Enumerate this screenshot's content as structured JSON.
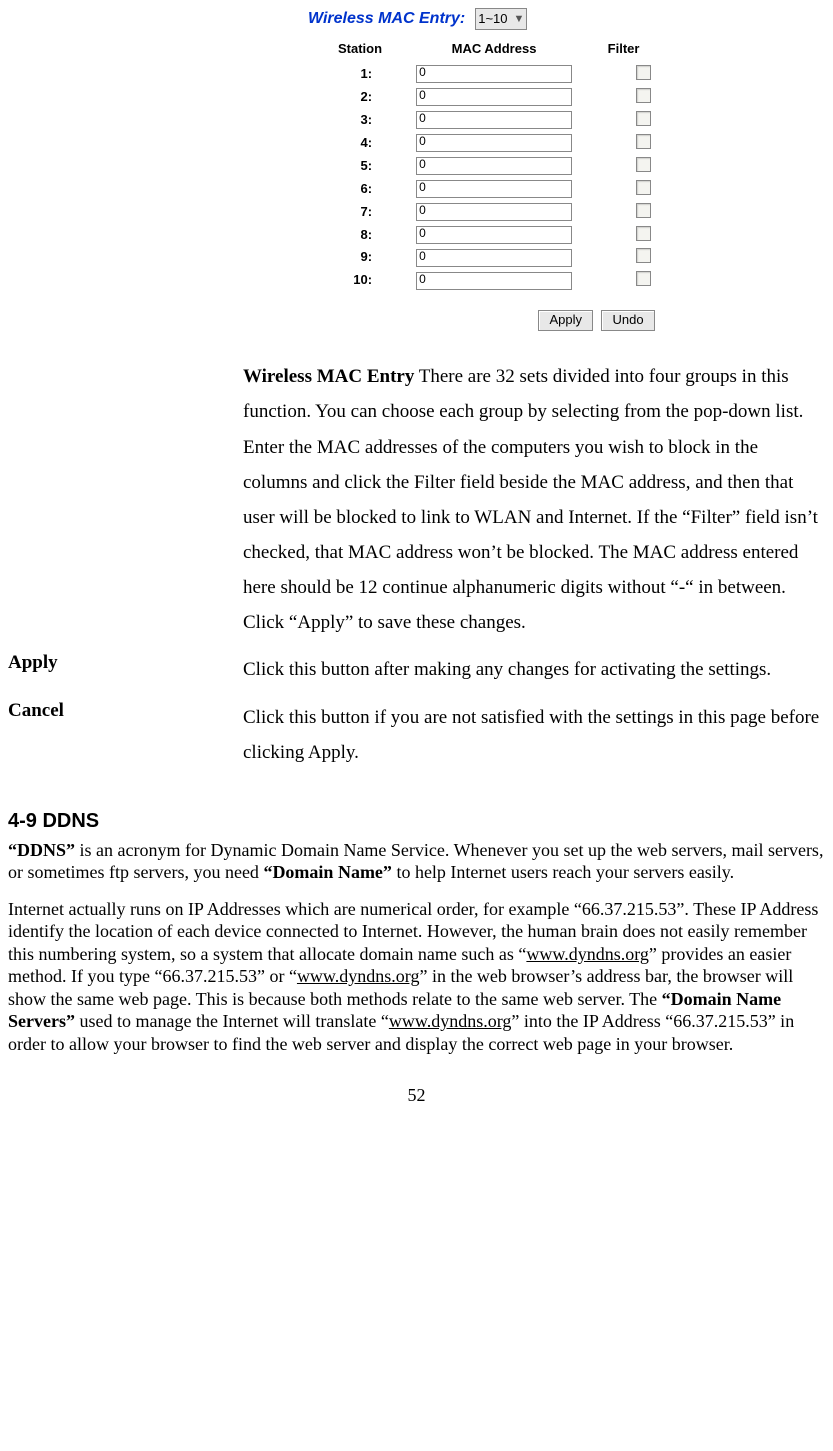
{
  "ui": {
    "title": "Wireless MAC Entry:",
    "range_selected": "1~10",
    "headers": {
      "station": "Station",
      "mac": "MAC Address",
      "filter": "Filter"
    },
    "rows": [
      {
        "station": "1:",
        "mac": "0"
      },
      {
        "station": "2:",
        "mac": "0"
      },
      {
        "station": "3:",
        "mac": "0"
      },
      {
        "station": "4:",
        "mac": "0"
      },
      {
        "station": "5:",
        "mac": "0"
      },
      {
        "station": "6:",
        "mac": "0"
      },
      {
        "station": "7:",
        "mac": "0"
      },
      {
        "station": "8:",
        "mac": "0"
      },
      {
        "station": "9:",
        "mac": "0"
      },
      {
        "station": "10:",
        "mac": "0"
      }
    ],
    "apply_btn": "Apply",
    "undo_btn": "Undo"
  },
  "descriptions": {
    "entry_lead": "Wireless MAC Entry",
    "entry_text": " There are 32 sets divided into four groups in this function. You can choose each group by selecting from the pop-down list. Enter the MAC addresses of the computers you wish to block in the columns and click the Filter field beside the MAC address, and then that user will be blocked to link to WLAN and Internet. If the “Filter” field isn’t checked, that MAC address won’t be blocked. The MAC address entered here should be 12 continue alphanumeric digits without “-“ in between. Click “Apply” to save these changes.",
    "apply_label": "Apply",
    "apply_text": "Click this button after making any changes for activating the settings.",
    "cancel_label": "Cancel",
    "cancel_text": "Click this button if you are not satisfied with the settings in this page before clicking Apply."
  },
  "section": {
    "heading": "4-9 DDNS",
    "p1_a": "“DDNS”",
    "p1_b": " is an acronym for Dynamic Domain Name Service. Whenever you set up the web servers, mail servers, or sometimes ftp servers, you need ",
    "p1_c": "“Domain Name”",
    "p1_d": " to help Internet users reach your servers easily.",
    "p2_a": "Internet actually runs on IP Addresses which are numerical order, for example “66.37.215.53”. These IP Address identify the location of each device connected to Internet. However, the human brain does not easily remember this numbering system, so a system that allocate domain name such as “",
    "link1": "www.dyndns.org",
    "p2_b": "” provides an easier method. If you type “66.37.215.53” or “",
    "link2": "www.dyndns.org",
    "p2_c": "” in the web browser’s address bar, the browser will show the same web page. This is because both methods relate to the same web server. The ",
    "p2_bold": "“Domain Name Servers”",
    "p2_d": " used to manage the Internet will translate “",
    "link3": "www.dyndns.org",
    "p2_e": "” into the IP Address “66.37.215.53” in order to allow your browser to find the web server and display the correct web page in your browser."
  },
  "page_number": "52"
}
